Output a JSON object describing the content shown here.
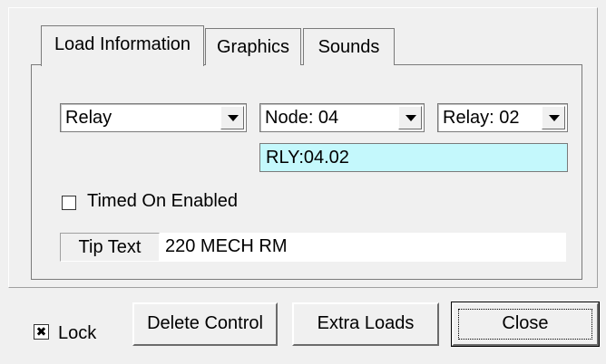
{
  "tabs": [
    {
      "label": "Load Information",
      "active": true
    },
    {
      "label": "Graphics",
      "active": false
    },
    {
      "label": "Sounds",
      "active": false
    }
  ],
  "load": {
    "type_value": "Relay",
    "node_value": "Node: 04",
    "relay_value": "Relay: 02",
    "address": "RLY:04.02"
  },
  "timed_on": {
    "label": "Timed On Enabled",
    "checked": false
  },
  "tip": {
    "label": "Tip Text",
    "value": "220 MECH RM"
  },
  "footer": {
    "lock_label": "Lock",
    "lock_checked": true,
    "delete_label": "Delete Control",
    "extra_label": "Extra Loads",
    "close_label": "Close"
  },
  "colors": {
    "address_bg": "#c4f8fc",
    "face": "#f0f0f0"
  }
}
